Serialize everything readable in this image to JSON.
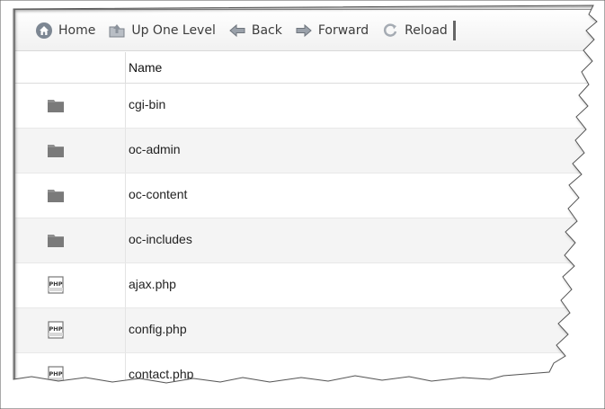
{
  "toolbar": {
    "home": {
      "label": "Home",
      "icon": "home-icon"
    },
    "up": {
      "label": "Up One Level",
      "icon": "up-folder-icon"
    },
    "back": {
      "label": "Back",
      "icon": "back-arrow-icon"
    },
    "forward": {
      "label": "Forward",
      "icon": "forward-arrow-icon"
    },
    "reload": {
      "label": "Reload",
      "icon": "reload-icon"
    }
  },
  "table": {
    "header_name": "Name",
    "rows": [
      {
        "name": "cgi-bin",
        "type": "folder"
      },
      {
        "name": "oc-admin",
        "type": "folder"
      },
      {
        "name": "oc-content",
        "type": "folder"
      },
      {
        "name": "oc-includes",
        "type": "folder"
      },
      {
        "name": "ajax.php",
        "type": "php"
      },
      {
        "name": "config.php",
        "type": "php"
      },
      {
        "name": "contact.php",
        "type": "php"
      }
    ]
  }
}
